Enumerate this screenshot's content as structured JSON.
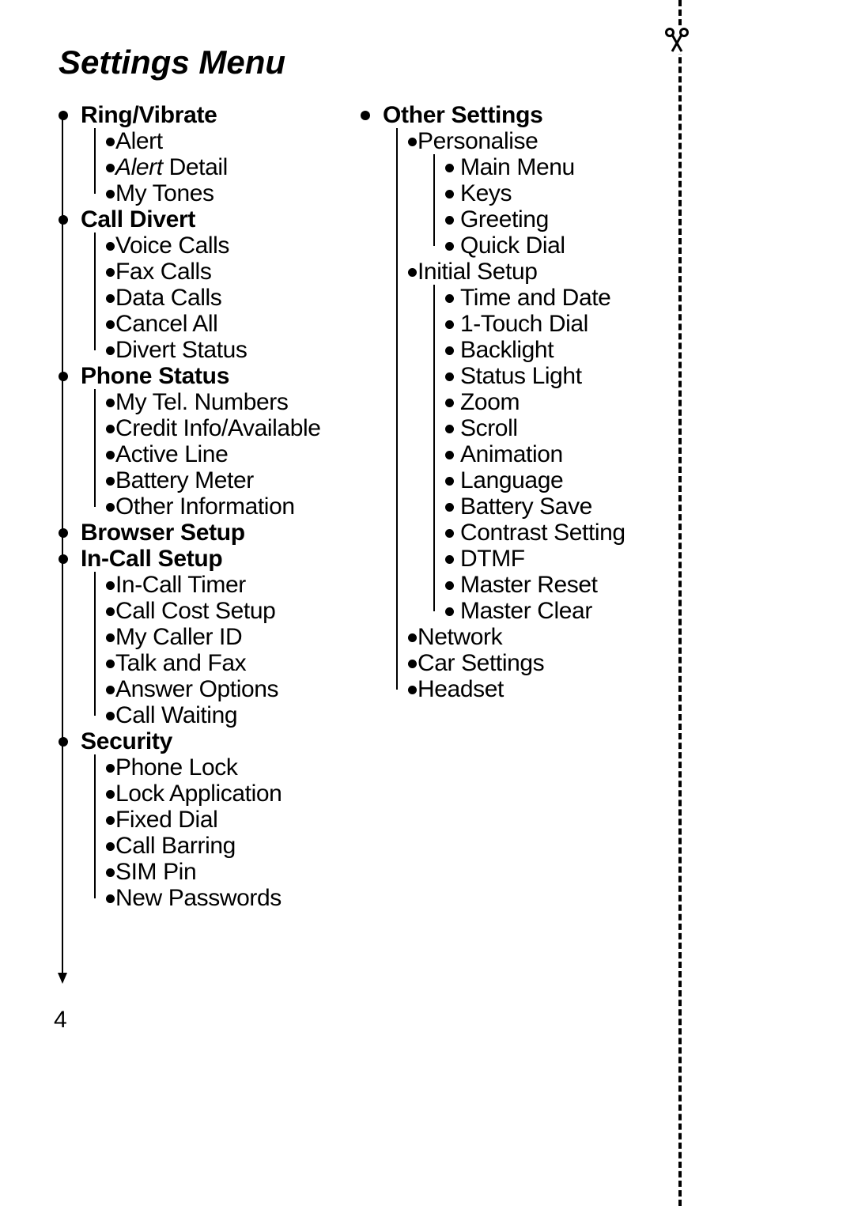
{
  "title": "Settings Menu",
  "page_number": "4",
  "left": {
    "ring_vibrate": {
      "label": "Ring/Vibrate",
      "items": [
        "Alert",
        "Alert Detail",
        "My Tones"
      ]
    },
    "call_divert": {
      "label": "Call Divert",
      "items": [
        "Voice Calls",
        "Fax Calls",
        "Data Calls",
        "Cancel All",
        "Divert Status"
      ]
    },
    "phone_status": {
      "label": "Phone Status",
      "items": [
        "My Tel. Numbers",
        "Credit Info/Available",
        "Active Line",
        "Battery Meter",
        "Other Information"
      ]
    },
    "browser_setup": {
      "label": "Browser Setup"
    },
    "in_call_setup": {
      "label": "In-Call Setup",
      "items": [
        "In-Call Timer",
        "Call Cost Setup",
        "My Caller ID",
        "Talk and Fax",
        "Answer Options",
        "Call Waiting"
      ]
    },
    "security": {
      "label": "Security",
      "items": [
        "Phone Lock",
        "Lock Application",
        "Fixed Dial",
        "Call Barring",
        "SIM Pin",
        "New Passwords"
      ]
    }
  },
  "right": {
    "other_settings": {
      "label": "Other Settings",
      "personalise": {
        "label": "Personalise",
        "items": [
          "Main Menu",
          "Keys",
          "Greeting",
          "Quick Dial"
        ]
      },
      "initial_setup": {
        "label": "Initial Setup",
        "items": [
          "Time and Date",
          "1-Touch Dial",
          "Backlight",
          "Status Light",
          "Zoom",
          "Scroll",
          "Animation",
          "Language",
          "Battery Save",
          "Contrast Setting",
          "DTMF",
          "Master Reset",
          "Master Clear"
        ]
      },
      "network": {
        "label": "Network"
      },
      "car_settings": {
        "label": "Car Settings"
      },
      "headset": {
        "label": "Headset"
      }
    }
  },
  "alert_detail_prefix": "Alert",
  "alert_detail_suffix": " Detail"
}
